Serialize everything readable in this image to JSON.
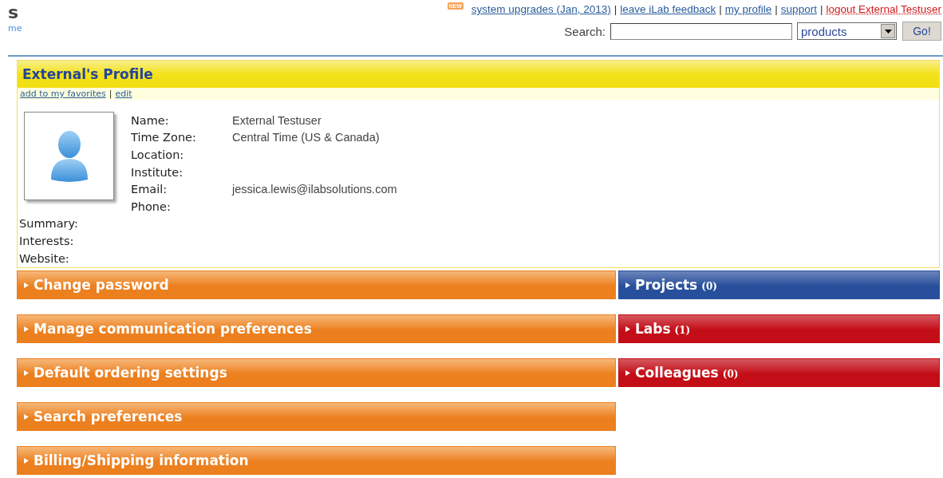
{
  "logo": {
    "letter": "s",
    "sub": "me"
  },
  "header": {
    "badge": "NEW",
    "links": [
      {
        "label": "system upgrades (Jan, 2013)",
        "kind": "normal"
      },
      {
        "label": "leave iLab feedback",
        "kind": "normal"
      },
      {
        "label": "my profile",
        "kind": "normal"
      },
      {
        "label": "support",
        "kind": "normal"
      },
      {
        "label": "logout External Testuser",
        "kind": "logout"
      }
    ],
    "separator": "|"
  },
  "search": {
    "label": "Search:",
    "scope": "products",
    "button": "Go!"
  },
  "profile": {
    "title": "External's Profile",
    "actions": [
      "add to my favorites",
      "edit"
    ],
    "separator": "|",
    "fields": [
      {
        "label": "Name:",
        "value": "External Testuser"
      },
      {
        "label": "Time Zone:",
        "value": "Central Time (US & Canada)"
      },
      {
        "label": "Location:"
      },
      {
        "label": "Institute:"
      },
      {
        "label": "Email:",
        "value": "jessica.lewis@ilabsolutions.com"
      },
      {
        "label": "Phone:"
      }
    ],
    "extra_fields": [
      {
        "label": "Summary:"
      },
      {
        "label": "Interests:"
      },
      {
        "label": "Website:"
      }
    ]
  },
  "left_panels": [
    {
      "title": "Change password"
    },
    {
      "title": "Manage communication preferences"
    },
    {
      "title": "Default ordering settings"
    },
    {
      "title": "Search preferences"
    },
    {
      "title": "Billing/Shipping information"
    }
  ],
  "right_panels": [
    {
      "title": "Projects",
      "count": "(0)",
      "color": "#284f9c"
    },
    {
      "title": "Labs",
      "count": "(1)",
      "color": "#c30d17"
    },
    {
      "title": "Colleagues",
      "count": "(0)",
      "color": "#c30d17"
    }
  ]
}
